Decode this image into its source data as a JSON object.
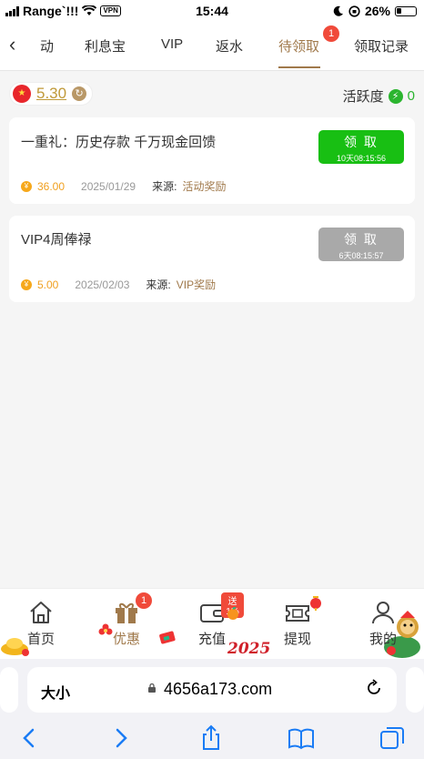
{
  "status_bar": {
    "carrier": "Range`!!!",
    "vpn": "VPN",
    "time": "15:44",
    "battery": "26%"
  },
  "tabs": {
    "items": [
      {
        "label": "动"
      },
      {
        "label": "利息宝"
      },
      {
        "label": "VIP"
      },
      {
        "label": "返水"
      },
      {
        "label": "待领取"
      },
      {
        "label": "领取记录"
      }
    ],
    "active_badge": "1"
  },
  "balance": {
    "flag": "★",
    "value": "5.30"
  },
  "activity": {
    "label": "活跃度",
    "value": "0"
  },
  "rewards": [
    {
      "title": "一重礼：历史存款 千万现金回馈",
      "button_label": "领 取",
      "countdown": "10天08:15:56",
      "state": "active",
      "amount": "36.00",
      "date": "2025/01/29",
      "source_label": "来源:",
      "source": "活动奖励"
    },
    {
      "title": "VIP4周俸禄",
      "button_label": "领 取",
      "countdown": "6天08:15:57",
      "state": "disabled",
      "amount": "5.00",
      "date": "2025/02/03",
      "source_label": "来源:",
      "source": "VIP奖励"
    }
  ],
  "bottom_nav": {
    "items": [
      {
        "label": "首页"
      },
      {
        "label": "优惠",
        "badge": "1"
      },
      {
        "label": "充值",
        "promo": "送1%"
      },
      {
        "label": "提现"
      },
      {
        "label": "我的"
      }
    ],
    "deco_year": "2025"
  },
  "browser": {
    "text_size_label": "大小",
    "url": "4656a173.com"
  },
  "colors": {
    "accent": "#a0794b",
    "green": "#18bf13",
    "badge": "#f04a3a",
    "disabled": "#a9a9a9"
  }
}
